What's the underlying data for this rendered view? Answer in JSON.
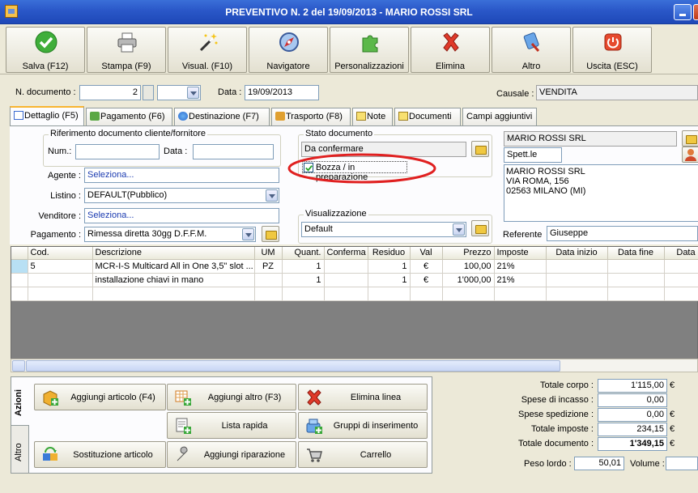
{
  "window": {
    "title": "PREVENTIVO N. 2 del 19/09/2013 - MARIO ROSSI SRL"
  },
  "toolbar": [
    {
      "label": "Salva (F12)",
      "icon": "check-icon"
    },
    {
      "label": "Stampa (F9)",
      "icon": "printer-icon"
    },
    {
      "label": "Visual. (F10)",
      "icon": "magic-wand-icon"
    },
    {
      "label": "Navigatore",
      "icon": "compass-icon"
    },
    {
      "label": "Personalizzazioni",
      "icon": "puzzle-icon"
    },
    {
      "label": "Elimina",
      "icon": "delete-x-icon"
    },
    {
      "label": "Altro",
      "icon": "tools-icon"
    },
    {
      "label": "Uscita (ESC)",
      "icon": "power-icon"
    }
  ],
  "header": {
    "doc_number_label": "N. documento :",
    "doc_number": "2",
    "date_label": "Data :",
    "date": "19/09/2013",
    "causale_label": "Causale :",
    "causale": "VENDITA"
  },
  "tabs": [
    "Dettaglio (F5)",
    "Pagamento (F6)",
    "Destinazione (F7)",
    "Trasporto (F8)",
    "Note",
    "Documenti",
    "Campi aggiuntivi"
  ],
  "detail": {
    "ref_group_title": "Riferimento documento cliente/fornitore",
    "num_label": "Num.:",
    "num_value": "",
    "data_label": "Data :",
    "data_value": "",
    "agente_label": "Agente :",
    "agente_value": "Seleziona...",
    "listino_label": "Listino :",
    "listino_value": "DEFAULT(Pubblico)",
    "venditore_label": "Venditore :",
    "venditore_value": "Seleziona...",
    "pagamento_label": "Pagamento :",
    "pagamento_value": "Rimessa diretta 30gg D.F.F.M.",
    "stato_title": "Stato documento",
    "stato_value": "Da confermare",
    "bozza_label": "Bozza / in preparazione",
    "visual_title": "Visualizzazione",
    "visual_value": "Default",
    "client_name": "MARIO ROSSI SRL",
    "client_salutation": "Spett.le",
    "client_address": [
      "MARIO ROSSI SRL",
      "VIA ROMA, 156",
      "02563 MILANO (MI)"
    ],
    "referente_label": "Referente",
    "referente_value": "Giuseppe"
  },
  "grid": {
    "columns": [
      "Cod.",
      "Descrizione",
      "UM",
      "Quant.",
      "Conferma",
      "Residuo",
      "Val",
      "Prezzo",
      "Imposte",
      "Data inizio",
      "Data fine",
      "Data"
    ],
    "rows": [
      [
        "5",
        "MCR-I-S Multicard All in One 3,5\" slot ...",
        "PZ",
        "1",
        "",
        "1",
        "€",
        "100,00",
        "21%",
        "",
        "",
        ""
      ],
      [
        "",
        "installazione chiavi in mano",
        "",
        "1",
        "",
        "1",
        "€",
        "1'000,00",
        "21%",
        "",
        "",
        ""
      ]
    ]
  },
  "actions": {
    "tab_azioni": "Azioni",
    "tab_altro": "Altro",
    "buttons": [
      {
        "label": "Aggiungi articolo (F4)",
        "icon": "add-article-icon"
      },
      {
        "label": "Aggiungi altro (F3)",
        "icon": "add-other-icon"
      },
      {
        "label": "Elimina linea",
        "icon": "delete-line-icon"
      },
      {
        "label": "Lista rapida",
        "icon": "quick-list-icon"
      },
      {
        "label": "Gruppi di inserimento",
        "icon": "insert-groups-icon"
      },
      {
        "label": "Sostituzione articolo",
        "icon": "replace-article-icon"
      },
      {
        "label": "Aggiungi riparazione",
        "icon": "repair-icon"
      },
      {
        "label": "Carrello",
        "icon": "cart-icon"
      }
    ]
  },
  "totals": {
    "corpo_label": "Totale corpo :",
    "corpo": "1'115,00",
    "incasso_label": "Spese di incasso :",
    "incasso": "0,00",
    "spedizione_label": "Spese spedizione :",
    "spedizione": "0,00",
    "imposte_label": "Totale imposte :",
    "imposte": "234,15",
    "documento_label": "Totale documento :",
    "documento": "1'349,15",
    "currency": "€",
    "peso_label": "Peso lordo :",
    "peso": "50,01",
    "volume_label": "Volume :",
    "volume": ""
  }
}
